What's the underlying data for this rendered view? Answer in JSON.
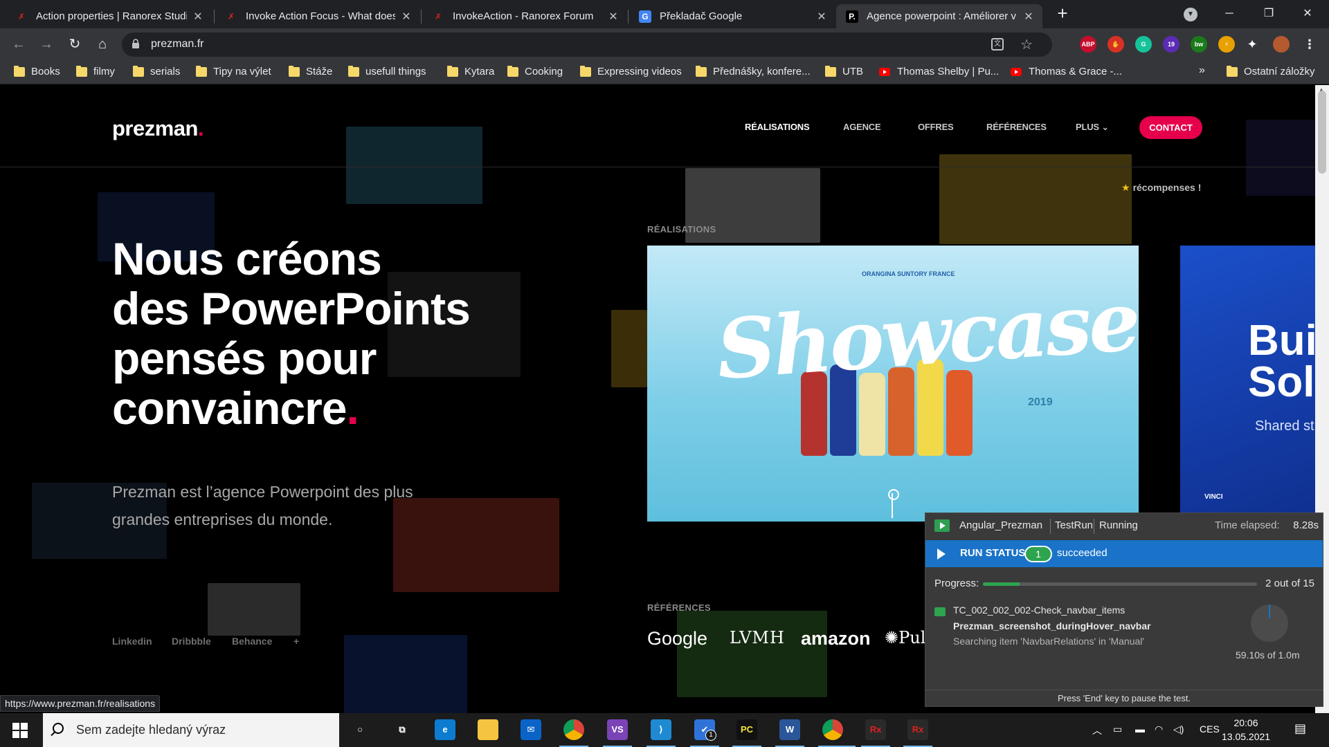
{
  "browser": {
    "tabs": [
      {
        "title": "Action properties | Ranorex Studio",
        "favicon": "ranorex-icon"
      },
      {
        "title": "Invoke Action Focus - What does",
        "favicon": "ranorex-icon"
      },
      {
        "title": "InvokeAction - Ranorex Forum",
        "favicon": "ranorex-icon"
      },
      {
        "title": "Překladač Google",
        "favicon": "google-translate-icon"
      },
      {
        "title": "Agence powerpoint : Améliorer v",
        "favicon": "prezman-icon",
        "active": true
      }
    ],
    "url": "prezman.fr",
    "extensions": [
      {
        "name": "adblock-plus-icon",
        "label": "ABP",
        "color": "#c70d2c"
      },
      {
        "name": "hand-extension-icon",
        "label": "✋",
        "color": "#d93025"
      },
      {
        "name": "grammarly-icon",
        "label": "G",
        "color": "#15c39a"
      },
      {
        "name": "badge-extension-icon",
        "label": "19",
        "color": "#5b2bb4"
      },
      {
        "name": "bw-extension-icon",
        "label": "bw",
        "color": "#1b7a1b"
      },
      {
        "name": "link-extension-icon",
        "label": "⚡",
        "color": "#e8a100"
      }
    ],
    "bookmarks": [
      {
        "label": "Books",
        "icon": "folder-icon"
      },
      {
        "label": "filmy",
        "icon": "folder-icon"
      },
      {
        "label": "serials",
        "icon": "folder-icon"
      },
      {
        "label": "Tipy na výlet",
        "icon": "folder-icon"
      },
      {
        "label": "Stáže",
        "icon": "folder-icon"
      },
      {
        "label": "usefull things",
        "icon": "folder-icon"
      },
      {
        "label": "Kytara",
        "icon": "folder-icon"
      },
      {
        "label": "Cooking",
        "icon": "folder-icon"
      },
      {
        "label": "Expressing videos",
        "icon": "folder-icon"
      },
      {
        "label": "Přednášky, konfere...",
        "icon": "folder-icon"
      },
      {
        "label": "UTB",
        "icon": "folder-icon"
      },
      {
        "label": "Thomas Shelby | Pu...",
        "icon": "youtube-icon"
      },
      {
        "label": "Thomas & Grace -...",
        "icon": "youtube-icon"
      }
    ],
    "bookmarks_overflow": "»",
    "other_bookmarks": "Ostatní záložky",
    "status_url": "https://www.prezman.fr/realisations"
  },
  "site": {
    "logo": "prezman",
    "logo_dot": ".",
    "nav": [
      {
        "label": "RÉALISATIONS"
      },
      {
        "label": "AGENCE"
      },
      {
        "label": "OFFRES"
      },
      {
        "label": "RÉFÉRENCES"
      },
      {
        "label": "PLUS"
      }
    ],
    "contact": "CONTACT",
    "awards": "récompenses !",
    "hero_lines": [
      "Nous créons",
      "des PowerPoints",
      "pensés pour",
      "convaincre"
    ],
    "hero_dot": ".",
    "hero_sub": "Prezman est l’agence Powerpoint des plus grandes entreprises du monde.",
    "social": [
      "Linkedin",
      "Dribbble",
      "Behance",
      "+"
    ],
    "realisations_label": "RÉALISATIONS",
    "showcase": {
      "brand": "ORANGINA SUNTORY FRANCE",
      "word": "Showcase",
      "year": "2019"
    },
    "vinci": {
      "big_lines": [
        "Bui",
        "Sol"
      ],
      "small": "Shared st",
      "logo": "VINCI"
    },
    "references_label": "RÉFÉRENCES",
    "references": [
      "Google",
      "LVMH",
      "amazon",
      "Pul"
    ]
  },
  "ranorex": {
    "solution": "Angular_Prezman",
    "run": "TestRun",
    "state": "Running",
    "elapsed_label": "Time elapsed:",
    "elapsed": "8.28s",
    "run_status_label": "RUN STATUS",
    "succeeded_count": "1",
    "succeeded_label": "succeeded",
    "progress_label": "Progress:",
    "progress_fraction": 0.133,
    "progress_text": "2 out of 15",
    "test_case": "TC_002_002_002-Check_navbar_items",
    "module": "Prezman_screenshot_duringHover_navbar",
    "searching": "Searching item 'NavbarRelations' in 'Manual'",
    "timeout_text": "59.10s of 1.0m",
    "footer": "Press 'End' key to pause the test."
  },
  "taskbar": {
    "search_placeholder": "Sem zadejte hledaný výraz",
    "apps": [
      {
        "name": "cortana-icon",
        "label": "○"
      },
      {
        "name": "task-view-icon",
        "label": "⧉"
      },
      {
        "name": "edge-icon",
        "label": "e"
      },
      {
        "name": "file-explorer-icon",
        "label": ""
      },
      {
        "name": "mail-icon",
        "label": "✉"
      },
      {
        "name": "chrome-icon",
        "label": ""
      },
      {
        "name": "visual-studio-icon",
        "label": "VS"
      },
      {
        "name": "vscode-icon",
        "label": "⟩"
      },
      {
        "name": "todo-icon",
        "label": "✔",
        "badge": "1"
      },
      {
        "name": "pycharm-icon",
        "label": "PC"
      },
      {
        "name": "word-icon",
        "label": "W"
      },
      {
        "name": "chrome-active-icon",
        "label": ""
      },
      {
        "name": "ranorex-studio-icon",
        "label": "Rx"
      },
      {
        "name": "ranorex-runner-icon",
        "label": "Rx"
      }
    ],
    "language": "CES",
    "time": "20:06",
    "date": "13.05.2021"
  }
}
